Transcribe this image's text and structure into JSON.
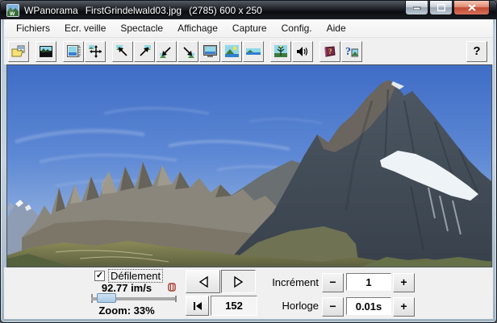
{
  "window": {
    "app": "WPanorama",
    "file": "FirstGrindelwald03.jpg",
    "size": "(2785) 600 x 250"
  },
  "menu": {
    "items": [
      "Fichiers",
      "Ecr. veille",
      "Spectacle",
      "Affichage",
      "Capture",
      "Config.",
      "Aide"
    ]
  },
  "toolbar": {
    "help_label": "?",
    "icons": [
      "open-file",
      "screensaver-preview",
      "panorama-window",
      "pan-arrows",
      "align-top-left",
      "align-top-right",
      "align-bottom-left",
      "align-bottom-right",
      "full-screen",
      "fit-image",
      "stretch-image",
      "slideshow-antenna",
      "sound",
      "help-book",
      "about"
    ]
  },
  "controls": {
    "defilement_label": "Défilement",
    "defilement_checked": "✓",
    "speed": "92.77 im/s",
    "zoom": "Zoom: 33%",
    "frame": "152",
    "increment_label": "Incrément",
    "increment_value": "1",
    "horloge_label": "Horloge",
    "horloge_value": "0.01s",
    "minus": "−",
    "plus": "+"
  },
  "colors": {
    "titlebar": "#16191e",
    "panel": "#f0f0f0",
    "sky_top": "#3f6dc6",
    "sky_bottom": "#b3c6e6",
    "close_button": "#c14a34",
    "slider_thumb": "#a9c8e4"
  }
}
